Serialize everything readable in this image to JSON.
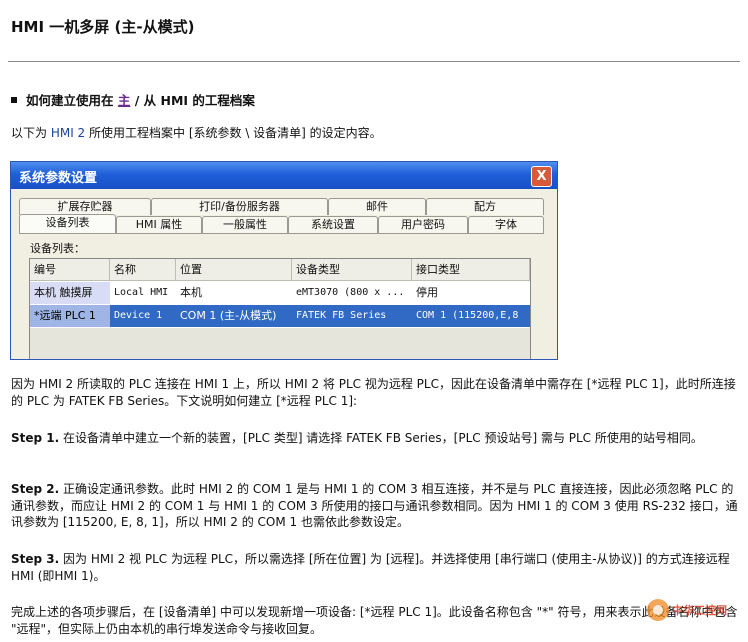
{
  "title": "HMI 一机多屏 (主-从模式)",
  "section": {
    "pre": "如何建立使用在",
    "link": "主",
    "post": " / 从 HMI 的工程档案"
  },
  "intro": {
    "a": "以下为 ",
    "b": "HMI 2",
    "c": " 所使用工程档案中 [系统参数 \\ 设备清单] 的设定内容。"
  },
  "dialog": {
    "title": "系统参数设置",
    "close": "X",
    "tabs_back": [
      "扩展存贮器",
      "打印/备份服务器",
      "邮件",
      "配方"
    ],
    "tabs_front": [
      "设备列表",
      "HMI 属性",
      "一般属性",
      "系统设置",
      "用户密码",
      "字体"
    ],
    "list_label": "设备列表：",
    "columns": [
      "编号",
      "名称",
      "位置",
      "设备类型",
      "接口类型"
    ],
    "rows": [
      [
        "本机 触摸屏",
        "Local HMI",
        "本机",
        "eMT3070 (800 x ...",
        "停用"
      ],
      [
        "*远端 PLC 1",
        "Device 1",
        "COM 1 (主-从模式)",
        "FATEK FB Series",
        "COM 1 (115200,E,8"
      ]
    ]
  },
  "para1": "因为 HMI 2 所读取的 PLC 连接在 HMI 1 上，所以 HMI 2 将 PLC 视为远程 PLC，因此在设备清单中需存在 [*远程 PLC 1]，此时所连接的 PLC 为 FATEK FB Series。下文说明如何建立 [*远程 PLC 1]:",
  "step1": {
    "label": "Step 1.",
    "text": " 在设备清单中建立一个新的装置，[PLC 类型] 请选择 FATEK FB Series，[PLC 预设站号] 需与 PLC 所使用的站号相同。"
  },
  "step2": {
    "label": "Step 2.",
    "text": " 正确设定通讯参数。此时 HMI 2 的 COM 1 是与 HMI 1 的 COM 3 相互连接，并不是与 PLC 直接连接，因此必须忽略 PLC 的通讯参数，而应让 HMI 2 的 COM 1 与 HMI 1 的 COM 3 所使用的接口与通讯参数相同。因为 HMI 1 的 COM 3 使用 RS-232 接口，通讯参数为 [115200, E, 8, 1]，所以 HMI 2 的 COM 1 也需依此参数设定。"
  },
  "step3": {
    "label": "Step 3.",
    "text": " 因为 HMI 2 视 PLC 为远程 PLC，所以需选择 [所在位置] 为 [远程]。并选择使用 [串行端口 (使用主-从协议)] 的方式连接远程 HMI (即HMI 1)。"
  },
  "para_end": "完成上述的各项步骤后，在 [设备清单] 中可以发现新增一项设备: [*远程 PLC 1]。此设备名称包含 \"*\" 符号，用来表示此设备名称中包含 \"远程\"，但实际上仍由本机的串行埠发送命令与接收回复。",
  "watermark": "中华工控网",
  "colors": {
    "titlebar": "#1f5fd8",
    "selected_row": "#316ac5",
    "link": "#6b2a8c",
    "term_blue": "#1f3fa0"
  }
}
